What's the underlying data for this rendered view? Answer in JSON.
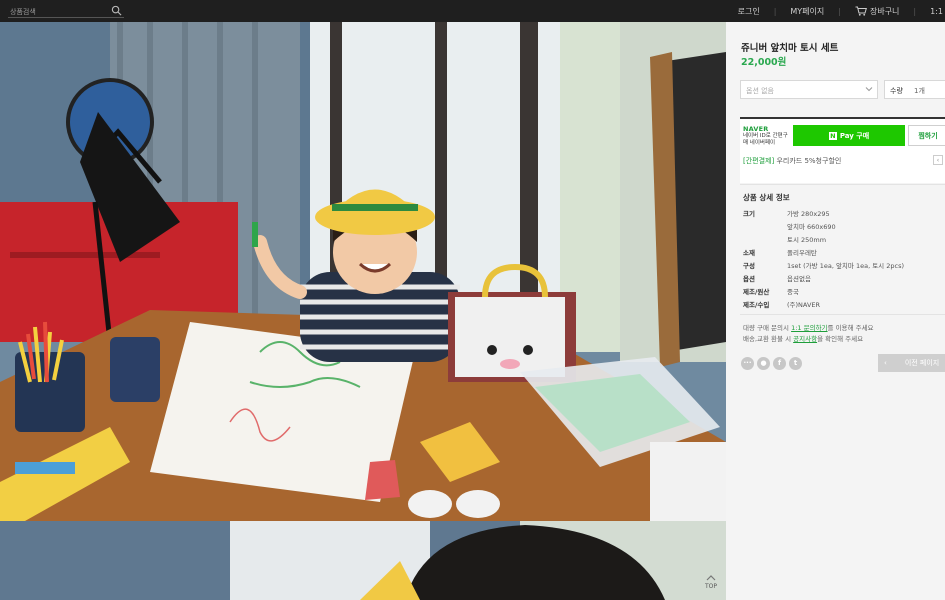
{
  "topbar": {
    "search_placeholder": "상품검색",
    "login": "로그인",
    "mypage": "MY페이지",
    "cart": "장바구니",
    "inquiry": "1:1",
    "sep": "|"
  },
  "product": {
    "title": "쥬니버 앞치마 토시 세트",
    "price": "22,000원"
  },
  "options": {
    "select_label": "옵션 없음",
    "qty_label": "수량",
    "qty_value": "1개"
  },
  "naverpay": {
    "logo": "NAVER",
    "desc": "네이버 ID로 간편구매 네이버페이",
    "pay_label": "Pay 구매",
    "pay_mark": "N",
    "wish_label": "찜하기",
    "promo_tag": "[간편결제]",
    "promo_text": "우리카드 5%청구할인",
    "promo_arrow": "‹"
  },
  "details": {
    "title": "상품 상세 정보",
    "specs": [
      {
        "key": "크기",
        "value": "가방 280x295"
      },
      {
        "key": "",
        "value": "앞치마 660x690"
      },
      {
        "key": "",
        "value": "토시 250mm"
      },
      {
        "key": "소재",
        "value": "폴리우레탄"
      },
      {
        "key": "구성",
        "value": "1set (가방 1ea, 앞치마 1ea, 토시 2pcs)"
      },
      {
        "key": "옵션",
        "value": "옵션없음"
      },
      {
        "key": "제조/원산",
        "value": "중국"
      },
      {
        "key": "제조/수입",
        "value": "(주)NAVER"
      }
    ],
    "notice1_pre": "대량 구매 문의시",
    "notice1_link": "1:1 문의하기",
    "notice1_post": "를 이용해 주세요",
    "notice2_pre": "배송,교환 환불 시",
    "notice2_link": "공지사항",
    "notice2_post": "을 확인해 주세요"
  },
  "nav": {
    "prev_page": "이전 페이지",
    "prev_arrow": "‹",
    "top": "TOP"
  },
  "social": [
    "···",
    "●",
    "f",
    "t"
  ],
  "colors": {
    "brand_green": "#1ec800",
    "price_green": "#2aa84f",
    "topbar_bg": "#1f1f1f"
  }
}
